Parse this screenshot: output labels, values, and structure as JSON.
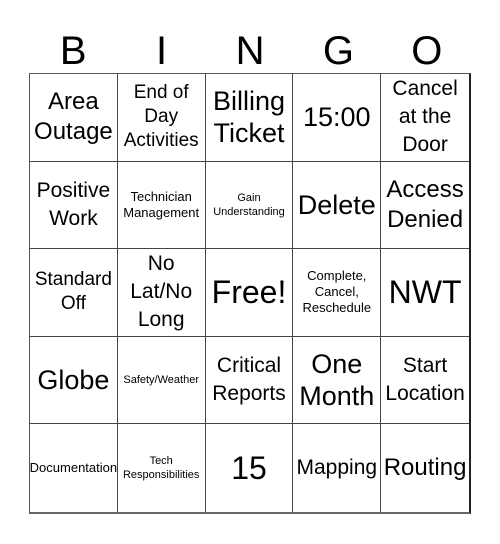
{
  "header": {
    "letters": [
      "B",
      "I",
      "N",
      "G",
      "O"
    ]
  },
  "cells": [
    {
      "text": "Area Outage",
      "size": "s-lg"
    },
    {
      "text": "End of Day Activities",
      "size": "s-md"
    },
    {
      "text": "Billing Ticket",
      "size": "s-xl"
    },
    {
      "text": "15:00",
      "size": "s-xl"
    },
    {
      "text": "Cancel at the Door",
      "size": "s-ml"
    },
    {
      "text": "Positive Work",
      "size": "s-ml"
    },
    {
      "text": "Technician Management",
      "size": "s-sm"
    },
    {
      "text": "Gain Understanding",
      "size": "s-xs"
    },
    {
      "text": "Delete",
      "size": "s-xl"
    },
    {
      "text": "Access Denied",
      "size": "s-lg"
    },
    {
      "text": "Standard Off",
      "size": "s-md"
    },
    {
      "text": "No Lat/No Long",
      "size": "s-ml"
    },
    {
      "text": "Free!",
      "size": "s-xxl"
    },
    {
      "text": "Complete, Cancel, Reschedule",
      "size": "s-sm"
    },
    {
      "text": "NWT",
      "size": "s-xxl"
    },
    {
      "text": "Globe",
      "size": "s-xl"
    },
    {
      "text": "Safety/Weather",
      "size": "s-xs"
    },
    {
      "text": "Critical Reports",
      "size": "s-ml"
    },
    {
      "text": "One Month",
      "size": "s-xl"
    },
    {
      "text": "Start Location",
      "size": "s-ml"
    },
    {
      "text": "Documentation",
      "size": "s-sm"
    },
    {
      "text": "Tech Responsibilities",
      "size": "s-xs"
    },
    {
      "text": "15",
      "size": "s-xxl"
    },
    {
      "text": "Mapping",
      "size": "s-ml"
    },
    {
      "text": "Routing",
      "size": "s-lg"
    }
  ]
}
